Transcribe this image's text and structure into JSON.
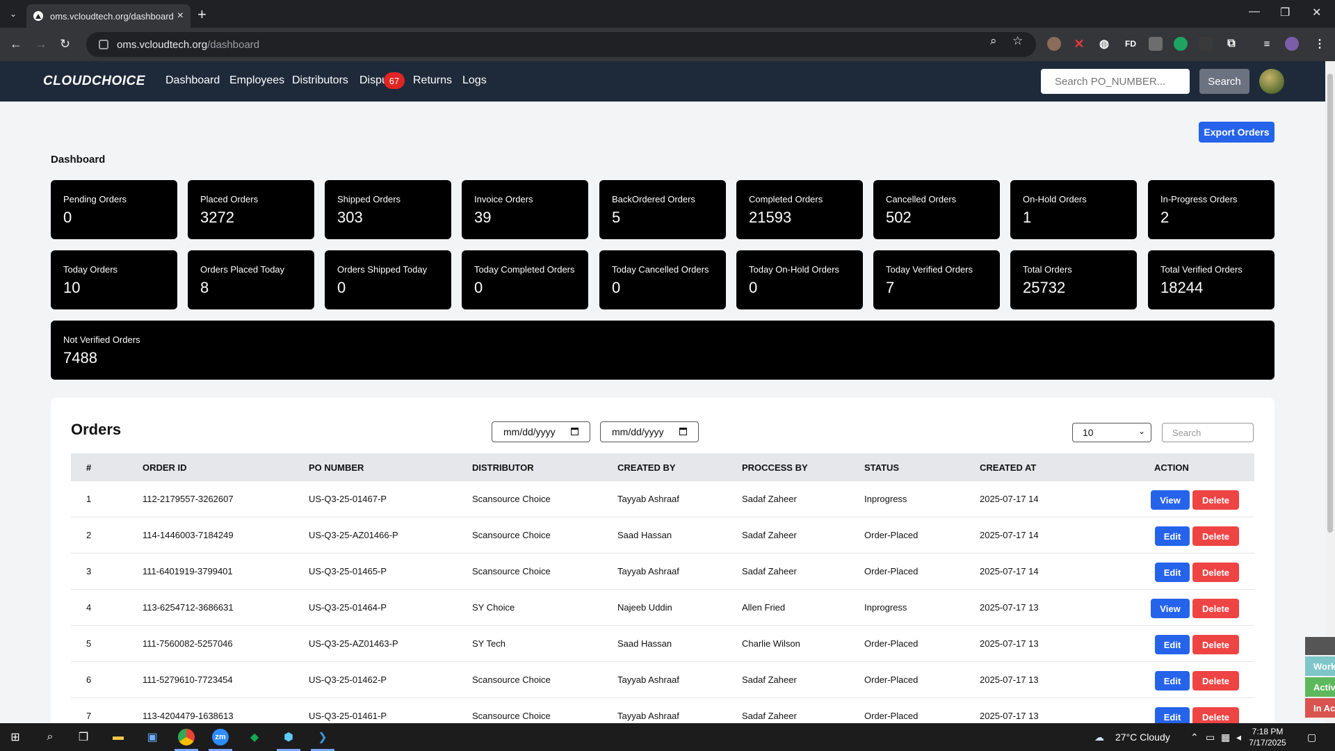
{
  "browser": {
    "tab_title": "oms.vcloudtech.org/dashboard",
    "url_host": "oms.vcloudtech.org",
    "url_path": "/dashboard",
    "new_tab": "+",
    "close_tab": "×",
    "ext_fd": "FD"
  },
  "nav": {
    "logo": "CLOUDCHOICE",
    "links": [
      "Dashboard",
      "Employees",
      "Distributors",
      "Dispu",
      "Returns",
      "Logs"
    ],
    "disputes_badge": "67",
    "search_placeholder": "Search PO_NUMBER...",
    "search_button": "Search"
  },
  "dashboard": {
    "export_button": "Export Orders",
    "title": "Dashboard",
    "cards_row1": [
      {
        "label": "Pending Orders",
        "value": "0"
      },
      {
        "label": "Placed Orders",
        "value": "3272"
      },
      {
        "label": "Shipped Orders",
        "value": "303"
      },
      {
        "label": "Invoice Orders",
        "value": "39"
      },
      {
        "label": "BackOrdered Orders",
        "value": "5"
      },
      {
        "label": "Completed Orders",
        "value": "21593"
      },
      {
        "label": "Cancelled Orders",
        "value": "502"
      },
      {
        "label": "On-Hold Orders",
        "value": "1"
      },
      {
        "label": "In-Progress Orders",
        "value": "2"
      }
    ],
    "cards_row2": [
      {
        "label": "Today Orders",
        "value": "10"
      },
      {
        "label": "Orders Placed Today",
        "value": "8"
      },
      {
        "label": "Orders Shipped Today",
        "value": "0"
      },
      {
        "label": "Today Completed Orders",
        "value": "0"
      },
      {
        "label": "Today Cancelled Orders",
        "value": "0"
      },
      {
        "label": "Today On-Hold Orders",
        "value": "0"
      },
      {
        "label": "Today Verified Orders",
        "value": "7"
      },
      {
        "label": "Total Orders",
        "value": "25732"
      },
      {
        "label": "Total Verified Orders",
        "value": "18244"
      }
    ],
    "not_verified": {
      "label": "Not Verified Orders",
      "value": "7488"
    }
  },
  "orders": {
    "title": "Orders",
    "date_from_placeholder": "mm/dd/yyyy",
    "date_to_placeholder": "mm/dd/yyyy",
    "page_size": "10",
    "search_placeholder": "Search",
    "columns": [
      "#",
      "ORDER ID",
      "PO NUMBER",
      "DISTRIBUTOR",
      "CREATED BY",
      "PROCCESS BY",
      "STATUS",
      "CREATED AT",
      "ACTION"
    ],
    "delete_label": "Delete",
    "rows": [
      {
        "n": "1",
        "order_id": "112-2179557-3262607",
        "po": "US-Q3-25-01467-P",
        "distributor": "Scansource Choice",
        "created_by": "Tayyab Ashraaf",
        "process_by": "Sadaf Zaheer",
        "status": "Inprogress",
        "created_at": "2025-07-17 14",
        "action": "View"
      },
      {
        "n": "2",
        "order_id": "114-1446003-7184249",
        "po": "US-Q3-25-AZ01466-P",
        "distributor": "Scansource Choice",
        "created_by": "Saad Hassan",
        "process_by": "Sadaf Zaheer",
        "status": "Order-Placed",
        "created_at": "2025-07-17 14",
        "action": "Edit"
      },
      {
        "n": "3",
        "order_id": "111-6401919-3799401",
        "po": "US-Q3-25-01465-P",
        "distributor": "Scansource Choice",
        "created_by": "Tayyab Ashraaf",
        "process_by": "Sadaf Zaheer",
        "status": "Order-Placed",
        "created_at": "2025-07-17 14",
        "action": "Edit"
      },
      {
        "n": "4",
        "order_id": "113-6254712-3686631",
        "po": "US-Q3-25-01464-P",
        "distributor": "SY Choice",
        "created_by": "Najeeb Uddin",
        "process_by": "Allen Fried",
        "status": "Inprogress",
        "created_at": "2025-07-17 13",
        "action": "View"
      },
      {
        "n": "5",
        "order_id": "111-7560082-5257046",
        "po": "US-Q3-25-AZ01463-P",
        "distributor": "SY Tech",
        "created_by": "Saad Hassan",
        "process_by": "Charlie Wilson",
        "status": "Order-Placed",
        "created_at": "2025-07-17 13",
        "action": "Edit"
      },
      {
        "n": "6",
        "order_id": "111-5279610-7723454",
        "po": "US-Q3-25-01462-P",
        "distributor": "Scansource Choice",
        "created_by": "Tayyab Ashraaf",
        "process_by": "Sadaf Zaheer",
        "status": "Order-Placed",
        "created_at": "2025-07-17 13",
        "action": "Edit"
      },
      {
        "n": "7",
        "order_id": "113-4204479-1638613",
        "po": "US-Q3-25-01461-P",
        "distributor": "Scansource Choice",
        "created_by": "Tayyab Ashraaf",
        "process_by": "Sadaf Zaheer",
        "status": "Order-Placed",
        "created_at": "2025-07-17 13",
        "action": "Edit"
      }
    ]
  },
  "side_tabs": [
    "Work",
    "Activ",
    "In Ac"
  ],
  "taskbar": {
    "zoom_label": "zm",
    "weather": "27°C  Cloudy",
    "time": "7:18 PM",
    "date": "7/17/2025"
  },
  "colors": {
    "navbar": "#1e2a3a",
    "primary": "#2563eb",
    "danger": "#ef4444",
    "badge": "#e02424",
    "card": "#000000"
  }
}
